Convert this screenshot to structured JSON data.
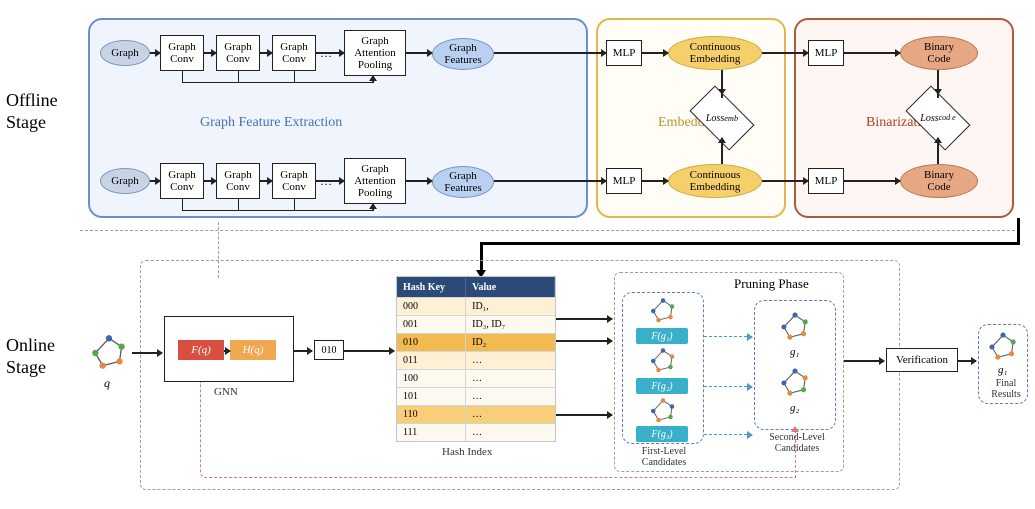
{
  "stages": {
    "offline": "Offline\nStage",
    "online": "Online\nStage"
  },
  "panels": {
    "gfe_title": "Graph Feature Extraction",
    "emb_title": "Embedding",
    "bin_title": "Binarization",
    "pruning_title": "Pruning Phase"
  },
  "blocks": {
    "graph": "Graph",
    "graph_conv": "Graph\nConv",
    "gap": "Graph\nAttention\nPooling",
    "graph_features": "Graph\nFeatures",
    "mlp": "MLP",
    "cont_emb": "Continuous\nEmbedding",
    "binary_code": "Binary\nCode",
    "loss_emb": "Loss",
    "loss_emb_sub": "emb",
    "loss_code": "Loss",
    "loss_code_sub": "cod\ne"
  },
  "gnn": {
    "fq": "F(q)",
    "hq": "H(q)",
    "code": "010",
    "caption": "GNN"
  },
  "query": {
    "symbol": "q"
  },
  "hash": {
    "caption": "Hash Index",
    "header_key": "Hash Key",
    "header_val": "Value",
    "rows": [
      {
        "k": "000",
        "v": "ID₁,",
        "shade": "shade1"
      },
      {
        "k": "001",
        "v": "ID₃, ID₇",
        "shade": "shade0"
      },
      {
        "k": "010",
        "v": "ID₂",
        "shade": "shade-strong"
      },
      {
        "k": "011",
        "v": "…",
        "shade": "shade1"
      },
      {
        "k": "100",
        "v": "…",
        "shade": "shade0"
      },
      {
        "k": "101",
        "v": "…",
        "shade": "shade0"
      },
      {
        "k": "110",
        "v": "…",
        "shade": "shade2"
      },
      {
        "k": "111",
        "v": "…",
        "shade": "shade0"
      }
    ]
  },
  "first_candidates": {
    "caption": "First-Level\nCandidates",
    "items": [
      "F(g₁)",
      "F(g₂)",
      "F(g₃)"
    ]
  },
  "second_candidates": {
    "caption": "Second-Level\nCandidates",
    "items": [
      "g₁",
      "g₂"
    ]
  },
  "verification": "Verification",
  "final": {
    "symbol": "g₁",
    "caption": "Final\nResults"
  }
}
